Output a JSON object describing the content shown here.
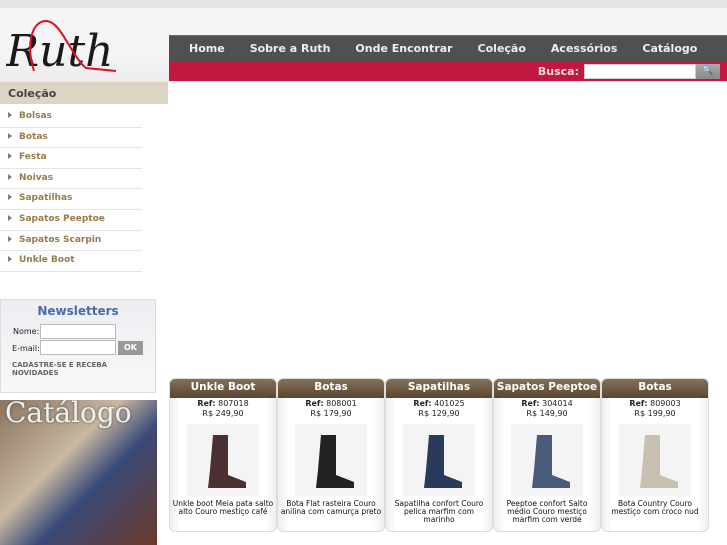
{
  "brand": {
    "logo_text": "Ruth"
  },
  "nav": {
    "items": [
      "Home",
      "Sobre a Ruth",
      "Onde Encontrar",
      "Coleção",
      "Acessórios",
      "Catálogo"
    ]
  },
  "search": {
    "label": "Busca:",
    "value": ""
  },
  "sidebar": {
    "title": "Coleção",
    "items": [
      "Bolsas",
      "Botas",
      "Festa",
      "Noivas",
      "Sapatilhas",
      "Sapatos Peeptoe",
      "Sapatos Scarpin",
      "Unkle Boot"
    ]
  },
  "newsletter": {
    "title": "Newsletters",
    "name_label": "Nome:",
    "email_label": "E-mail:",
    "ok_label": "OK",
    "cta": "CADASTRE-SE E RECEBA NOVIDADES"
  },
  "catalog": {
    "label": "Catálogo"
  },
  "products": [
    {
      "category": "Unkle Boot",
      "ref_label": "Ref:",
      "ref": "807018",
      "price": "R$ 249,90",
      "desc": "Unkle boot Meia pata salto alto Couro mestiço café",
      "color": "#4a3030"
    },
    {
      "category": "Botas",
      "ref_label": "Ref:",
      "ref": "808001",
      "price": "R$ 179,90",
      "desc": "Bota Flat rasteira Couro anilina com camurça preto",
      "color": "#222"
    },
    {
      "category": "Sapatilhas",
      "ref_label": "Ref:",
      "ref": "401025",
      "price": "R$ 129,90",
      "desc": "Sapatilha confort Couro pelica marfim com marinho",
      "color": "#2a3a5a"
    },
    {
      "category": "Sapatos Peeptoe",
      "ref_label": "Ref:",
      "ref": "304014",
      "price": "R$ 149,90",
      "desc": "Peeptoe confort Salto médio Couro mestiço marfim com verde",
      "color": "#4a5a7a"
    },
    {
      "category": "Botas",
      "ref_label": "Ref:",
      "ref": "809003",
      "price": "R$ 199,90",
      "desc": "Bota Country Couro mestiço com croco nud",
      "color": "#c8c0b0"
    }
  ]
}
